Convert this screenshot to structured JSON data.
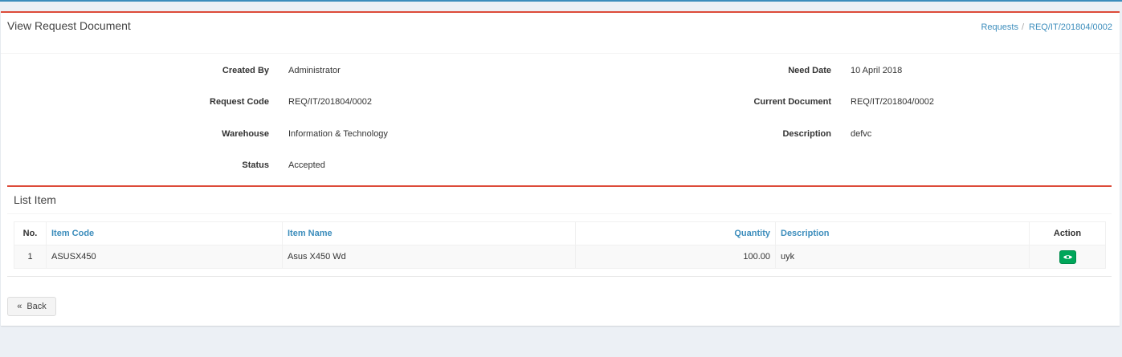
{
  "header": {
    "title": "View Request Document",
    "breadcrumb": [
      "Requests",
      "REQ/IT/201804/0002"
    ],
    "breadcrumb_separator": "/"
  },
  "details": {
    "created_by_label": "Created By",
    "created_by": "Administrator",
    "request_code_label": "Request Code",
    "request_code": "REQ/IT/201804/0002",
    "warehouse_label": "Warehouse",
    "warehouse": "Information & Technology",
    "status_label": "Status",
    "status": "Accepted",
    "need_date_label": "Need Date",
    "need_date": "10 April 2018",
    "current_document_label": "Current Document",
    "current_document": "REQ/IT/201804/0002",
    "description_label": "Description",
    "description": "defvc"
  },
  "list": {
    "title": "List Item",
    "columns": [
      "No.",
      "Item Code",
      "Item Name",
      "Quantity",
      "Description",
      "Action"
    ],
    "rows": [
      {
        "no": "1",
        "item_code": "ASUSX450",
        "item_name": "Asus X450 Wd",
        "quantity": "100.00",
        "description": "uyk",
        "action_icon": "eye-icon"
      }
    ]
  },
  "footer": {
    "back_label": "Back",
    "back_icon": "double-chevron-left-icon"
  },
  "colors": {
    "accent": "#dd4b39",
    "link": "#3c8dbc",
    "success": "#00a65a"
  }
}
